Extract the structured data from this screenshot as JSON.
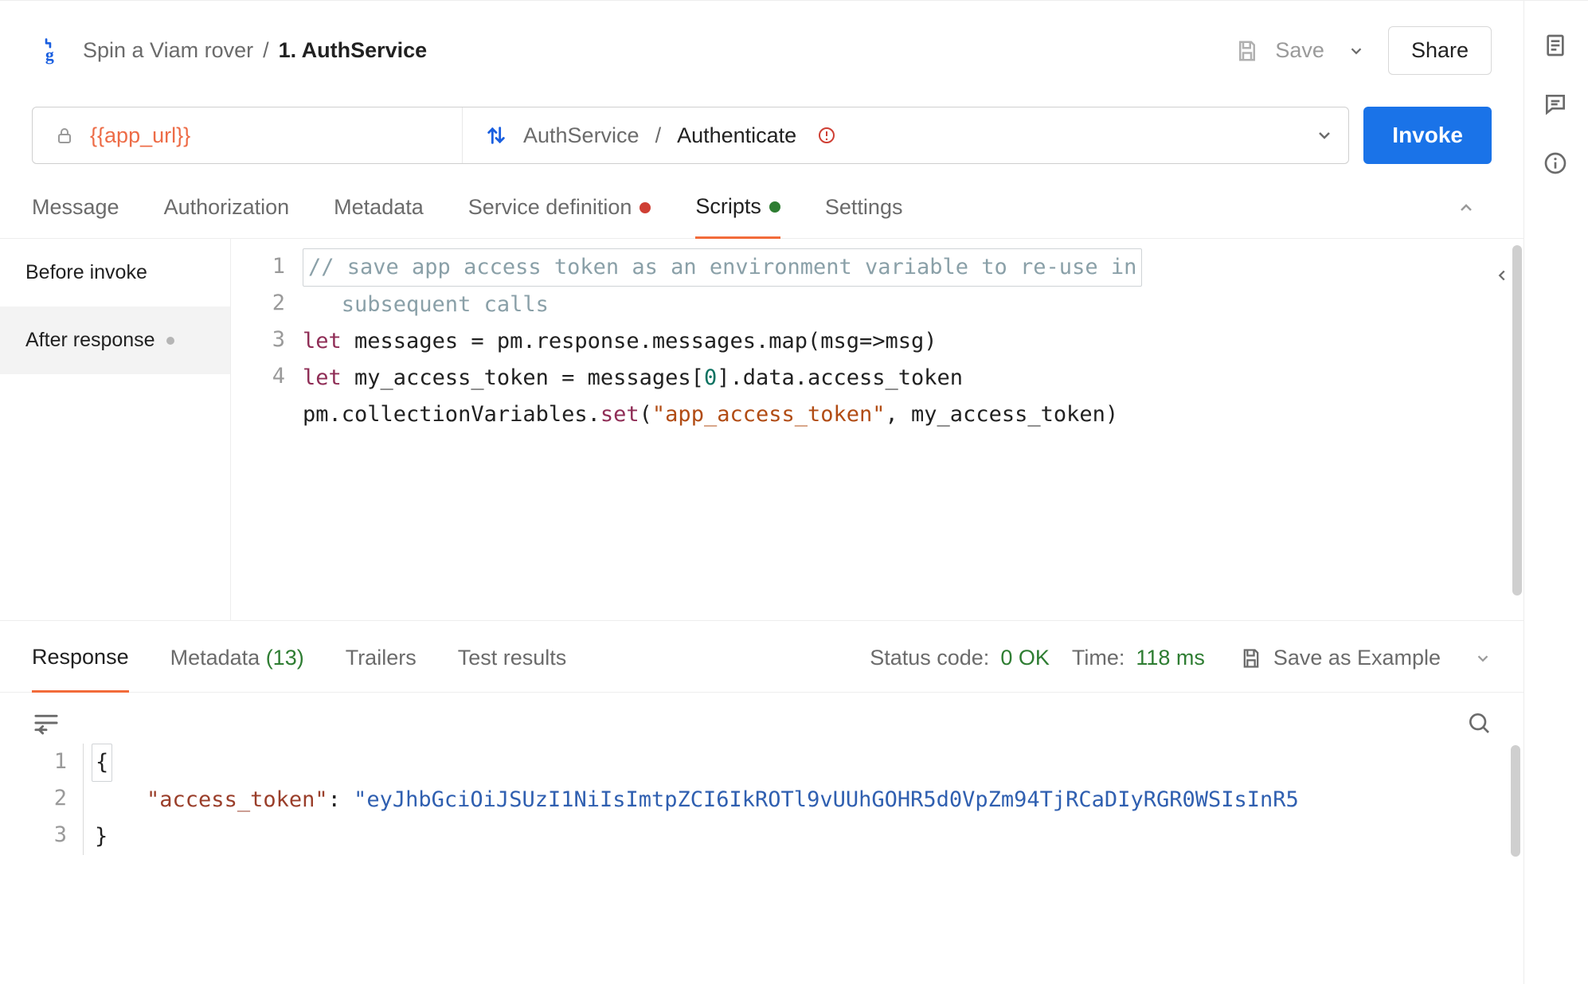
{
  "breadcrumb": {
    "parent": "Spin a Viam rover",
    "sep": "/",
    "current": "1. AuthService"
  },
  "actions": {
    "save": "Save",
    "share": "Share"
  },
  "url": {
    "variable": "{{app_url}}",
    "service": "AuthService",
    "sep": "/",
    "method": "Authenticate"
  },
  "invoke": "Invoke",
  "tabs": {
    "message": "Message",
    "authorization": "Authorization",
    "metadata": "Metadata",
    "service_definition": "Service definition",
    "scripts": "Scripts",
    "settings": "Settings"
  },
  "scripts_side": {
    "before": "Before invoke",
    "after": "After response"
  },
  "script_lines": {
    "l1": "1",
    "l2": "2",
    "l3": "3",
    "l4": "4"
  },
  "code": {
    "c1a": "// save app access token as an environment variable to re-use in",
    "c1b": "   subsequent calls",
    "c2_let": "let",
    "c2_rest": " messages = pm.response.messages.map(msg=>msg)",
    "c3_let": "let",
    "c3_a": " my_access_token = messages[",
    "c3_zero": "0",
    "c3_b": "].data.access_token",
    "c4_a": "pm.collectionVariables.",
    "c4_set": "set",
    "c4_b": "(",
    "c4_str": "\"app_access_token\"",
    "c4_c": ", my_access_token)"
  },
  "response_tabs": {
    "response": "Response",
    "metadata": "Metadata",
    "metadata_count": "(13)",
    "trailers": "Trailers",
    "test_results": "Test results"
  },
  "response_meta": {
    "status_label": "Status code:",
    "status_value": "0 OK",
    "time_label": "Time:",
    "time_value": "118 ms",
    "save_example": "Save as Example"
  },
  "response_lines": {
    "l1": "1",
    "l2": "2",
    "l3": "3"
  },
  "response_body": {
    "open": "{",
    "key": "\"access_token\"",
    "colon": ": ",
    "value": "\"eyJhbGciOiJSUzI1NiIsImtpZCI6IkROTl9vUUhGOHR5d0VpZm94TjRCaDIyRGR0WSIsInR5",
    "close": "}"
  }
}
